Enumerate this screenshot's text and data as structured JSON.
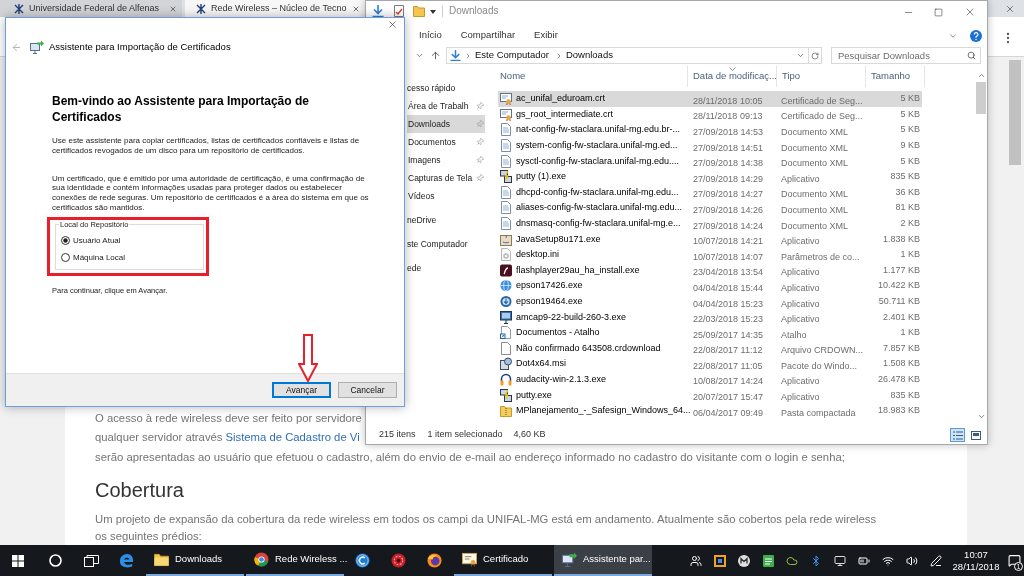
{
  "browser": {
    "tabs": [
      {
        "title": "Universidade Federal de Alfenas",
        "selected": false
      },
      {
        "title": "Rede Wireless – Núcleo de Tecno",
        "selected": true
      }
    ],
    "page": {
      "lines": [
        {
          "text": "O acesso à rede wireless deve ser feito por servidore"
        },
        {
          "text": "qualquer servidor através",
          "link": "Sistema de Cadastro de Vi"
        },
        {
          "text": "serão apresentadas ao usuário que efetuou o cadastro, além do envio de e-mail ao endereço informado no cadastro do visitante com o login e senha;"
        }
      ],
      "heading": "Cobertura",
      "paragraph": "Um projeto de expansão da cobertura da rede wireless em todos os campi da UNIFAL-MG está em andamento. Atualmente são cobertos pela rede wireless os seguintes prédios:"
    }
  },
  "explorer": {
    "title": "Downloads",
    "ribbon_tabs": [
      "Início",
      "Compartilhar",
      "Exibir"
    ],
    "address": [
      "Este Computador",
      "Downloads"
    ],
    "search": {
      "placeholder": "Pesquisar Downloads"
    },
    "navigation": [
      {
        "label": "cesso rápido",
        "selected": false,
        "children": [
          {
            "label": "Área de Trabalh",
            "selected": false,
            "pinned": true
          },
          {
            "label": "Downloads",
            "selected": true,
            "pinned": true
          },
          {
            "label": "Documentos",
            "selected": false,
            "pinned": true
          },
          {
            "label": "Imagens",
            "selected": false,
            "pinned": true
          },
          {
            "label": "Capturas de Tela",
            "selected": false,
            "pinned": true
          },
          {
            "label": "Vídeos",
            "selected": false,
            "pinned": false
          }
        ]
      },
      {
        "label": "neDrive",
        "selected": false
      },
      {
        "label": "ste Computador",
        "selected": false
      },
      {
        "label": "ede",
        "selected": false
      }
    ],
    "columns": [
      {
        "label": "Nome",
        "sorted": false
      },
      {
        "label": "Data de modificaç...",
        "sorted": true
      },
      {
        "label": "Tipo",
        "sorted": false
      },
      {
        "label": "Tamanho",
        "sorted": false
      }
    ],
    "files": [
      {
        "kind": "certificate",
        "name": "ac_unifal_eduroam.crt",
        "date": "28/11/2018 10:05",
        "type": "Certificado de Seg...",
        "size": "5 KB",
        "selected": true
      },
      {
        "kind": "certificate",
        "name": "gs_root_intermediate.crt",
        "date": "28/11/2018 09:13",
        "type": "Certificado de Seg...",
        "size": "5 KB",
        "selected": false
      },
      {
        "kind": "xml",
        "name": "nat-config-fw-staclara.unifal-mg.edu.br-...",
        "date": "27/09/2018 14:53",
        "type": "Documento XML",
        "size": "5 KB",
        "selected": false
      },
      {
        "kind": "xml",
        "name": "system-config-fw-staclara.unifal-mg.ed...",
        "date": "27/09/2018 14:51",
        "type": "Documento XML",
        "size": "9 KB",
        "selected": false
      },
      {
        "kind": "xml",
        "name": "sysctl-config-fw-staclara.unifal-mg.edu....",
        "date": "27/09/2018 14:38",
        "type": "Documento XML",
        "size": "5 KB",
        "selected": false
      },
      {
        "kind": "network-app",
        "name": "putty (1).exe",
        "date": "27/09/2018 14:29",
        "type": "Aplicativo",
        "size": "835 KB",
        "selected": false
      },
      {
        "kind": "xml",
        "name": "dhcpd-config-fw-staclara.unifal-mg.edu...",
        "date": "27/09/2018 14:27",
        "type": "Documento XML",
        "size": "36 KB",
        "selected": false
      },
      {
        "kind": "xml",
        "name": "aliases-config-fw-staclara.unifal-mg.edu...",
        "date": "27/09/2018 14:26",
        "type": "Documento XML",
        "size": "81 KB",
        "selected": false
      },
      {
        "kind": "xml",
        "name": "dnsmasq-config-fw-staclara.unifal-mg.e...",
        "date": "27/09/2018 14:24",
        "type": "Documento XML",
        "size": "2 KB",
        "selected": false
      },
      {
        "kind": "setup",
        "name": "JavaSetup8u171.exe",
        "date": "10/07/2018 14:21",
        "type": "Aplicativo",
        "size": "1.838 KB",
        "selected": false
      },
      {
        "kind": "settings-file",
        "name": "desktop.ini",
        "date": "10/07/2018 14:07",
        "type": "Parâmetros de co...",
        "size": "1 KB",
        "selected": false
      },
      {
        "kind": "app-tile",
        "name": "flashplayer29au_ha_install.exe",
        "date": "23/04/2018 13:54",
        "type": "Aplicativo",
        "size": "1.177 KB",
        "selected": false
      },
      {
        "kind": "globe-app",
        "name": "epson17426.exe",
        "date": "04/04/2018 15:44",
        "type": "Aplicativo",
        "size": "10.422 KB",
        "selected": false
      },
      {
        "kind": "disc-app",
        "name": "epson19464.exe",
        "date": "04/04/2018 15:23",
        "type": "Aplicativo",
        "size": "50.711 KB",
        "selected": false
      },
      {
        "kind": "camera-app",
        "name": "amcap9-22-build-260-3.exe",
        "date": "22/03/2018 15:23",
        "type": "Aplicativo",
        "size": "2.401 KB",
        "selected": false
      },
      {
        "kind": "shortcut",
        "name": "Documentos - Atalho",
        "date": "25/09/2017 14:35",
        "type": "Atalho",
        "size": "1 KB",
        "selected": false
      },
      {
        "kind": "blank",
        "name": "Não confirmado 643508.crdownload",
        "date": "22/08/2017 11:12",
        "type": "Arquivo CRDOWN...",
        "size": "7.857 KB",
        "selected": false
      },
      {
        "kind": "package",
        "name": "Dot4x64.msi",
        "date": "22/08/2017 11:05",
        "type": "Pacote do Windo...",
        "size": "1.508 KB",
        "selected": false
      },
      {
        "kind": "headphones",
        "name": "audacity-win-2.1.3.exe",
        "date": "10/08/2017 14:24",
        "type": "Aplicativo",
        "size": "26.478 KB",
        "selected": false
      },
      {
        "kind": "network-app",
        "name": "putty.exe",
        "date": "20/07/2017 15:47",
        "type": "Aplicativo",
        "size": "835 KB",
        "selected": false
      },
      {
        "kind": "zip",
        "name": "MPlanejamento_-_Safesign_Windows_64...",
        "date": "06/04/2017 09:49",
        "type": "Pasta compactada",
        "size": "18.983 KB",
        "selected": false
      }
    ],
    "status_bar": {
      "count": "215 itens",
      "selection": "1 item selecionado",
      "size": "4,60 KB",
      "views": [
        {
          "kind": "details",
          "selected": true
        },
        {
          "kind": "large-icons",
          "selected": false
        }
      ]
    }
  },
  "dialog": {
    "title": "Assistente para Importação de Certificados",
    "heading": "Bem-vindo ao Assistente para Importação de Certificados",
    "paragraphs": [
      "Use este assistente para copiar certificados, listas de certificados confiáveis e listas de certificados revogados de um disco para um repositório de certificados.",
      "Um certificado, que é emitido por uma autoridade de certificação, é uma confirmação de sua identidade e contém informações usadas para proteger dados ou estabelecer conexões de rede seguras. Um repositório de certificados é a área do sistema em que os certificados são mantidos."
    ],
    "group": {
      "label": "Local do Repositório",
      "options": [
        {
          "label": "Usuário Atual",
          "selected": true
        },
        {
          "label": "Máquina Local",
          "selected": false
        }
      ]
    },
    "hint": "Para continuar, clique em Avançar.",
    "buttons": [
      {
        "label": "Avançar",
        "default": true
      },
      {
        "label": "Cancelar",
        "default": false
      }
    ]
  },
  "taskbar": {
    "items": [
      {
        "kind": "e-logo"
      },
      {
        "kind": "folder",
        "label": "Downloads",
        "selected": false
      },
      {
        "kind": "browser",
        "label": "Rede Wireless ...",
        "selected": false
      },
      {
        "kind": "c-logo"
      },
      {
        "kind": "emblem"
      },
      {
        "kind": "flame-globe"
      },
      {
        "kind": "certificate",
        "label": "Certificado",
        "selected": false
      },
      {
        "kind": "wizard",
        "label": "Assistente par...",
        "selected": true
      }
    ],
    "clock": {
      "time": "10:07",
      "date": "28/11/2018"
    },
    "notifications": "1"
  }
}
